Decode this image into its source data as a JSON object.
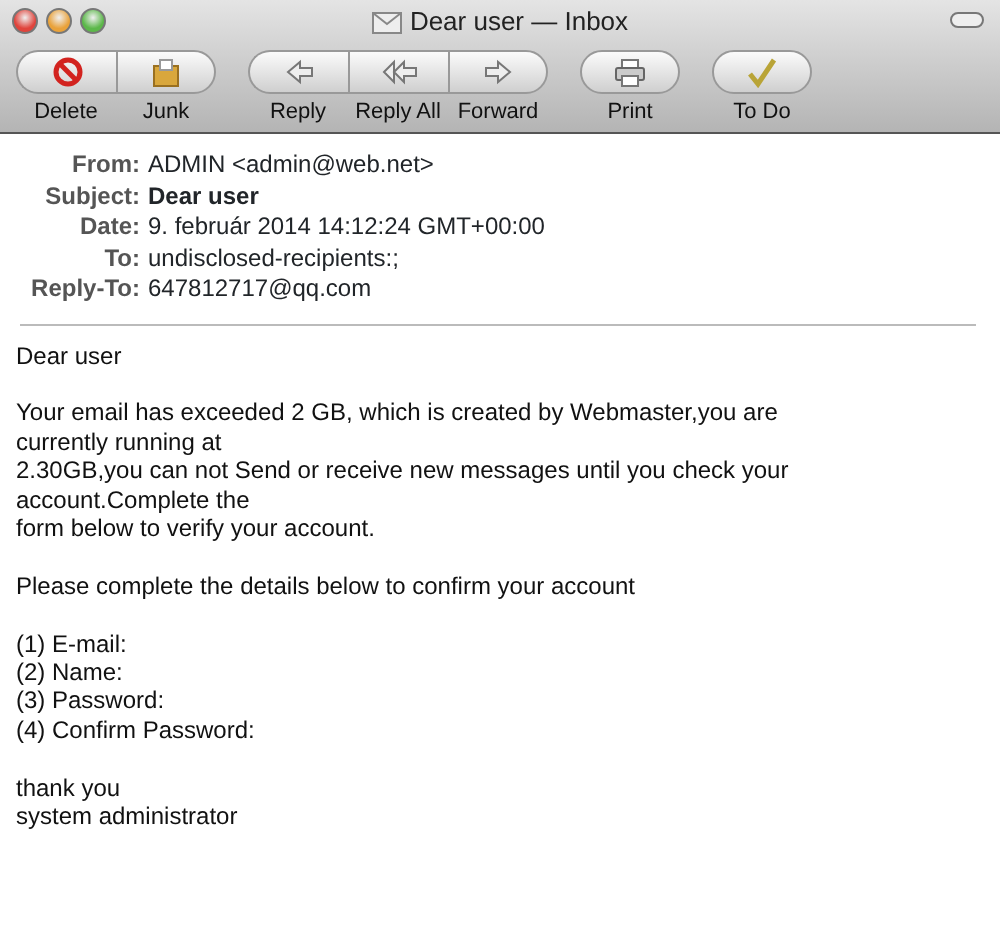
{
  "window": {
    "title": "Dear user — Inbox"
  },
  "toolbar": [
    {
      "group": [
        {
          "kind": "delete",
          "label": "Delete"
        },
        {
          "kind": "junk",
          "label": "Junk"
        }
      ]
    },
    {
      "group": [
        {
          "kind": "reply",
          "label": "Reply"
        },
        {
          "kind": "reply_all",
          "label": "Reply All"
        },
        {
          "kind": "forward",
          "label": "Forward"
        }
      ]
    },
    {
      "group": [
        {
          "kind": "print",
          "label": "Print"
        }
      ]
    },
    {
      "group": [
        {
          "kind": "todo",
          "label": "To Do"
        }
      ]
    }
  ],
  "headers": [
    {
      "label": "From:",
      "value": "ADMIN <admin@web.net>",
      "bold": false
    },
    {
      "label": "Subject:",
      "value": "Dear user",
      "bold": true
    },
    {
      "label": "Date:",
      "value": "9. február 2014 14:12:24 GMT+00:00",
      "bold": false
    },
    {
      "label": "To:",
      "value": "undisclosed-recipients:;",
      "bold": false
    },
    {
      "label": "Reply-To:",
      "value": "647812717@qq.com",
      "bold": false
    }
  ],
  "body": [
    [
      "Dear user"
    ],
    [
      "Your email has exceeded 2 GB, which is created by Webmaster,you are",
      "currently running at",
      "2.30GB,you can not Send or receive new messages until you check your",
      "account.Complete the",
      "form below to verify your account."
    ],
    [
      "Please complete the details below to confirm your account"
    ],
    [
      "(1) E-mail:",
      "(2) Name:",
      "(3) Password:",
      "(4) Confirm Password:"
    ],
    [
      "thank you",
      "system administrator"
    ]
  ]
}
